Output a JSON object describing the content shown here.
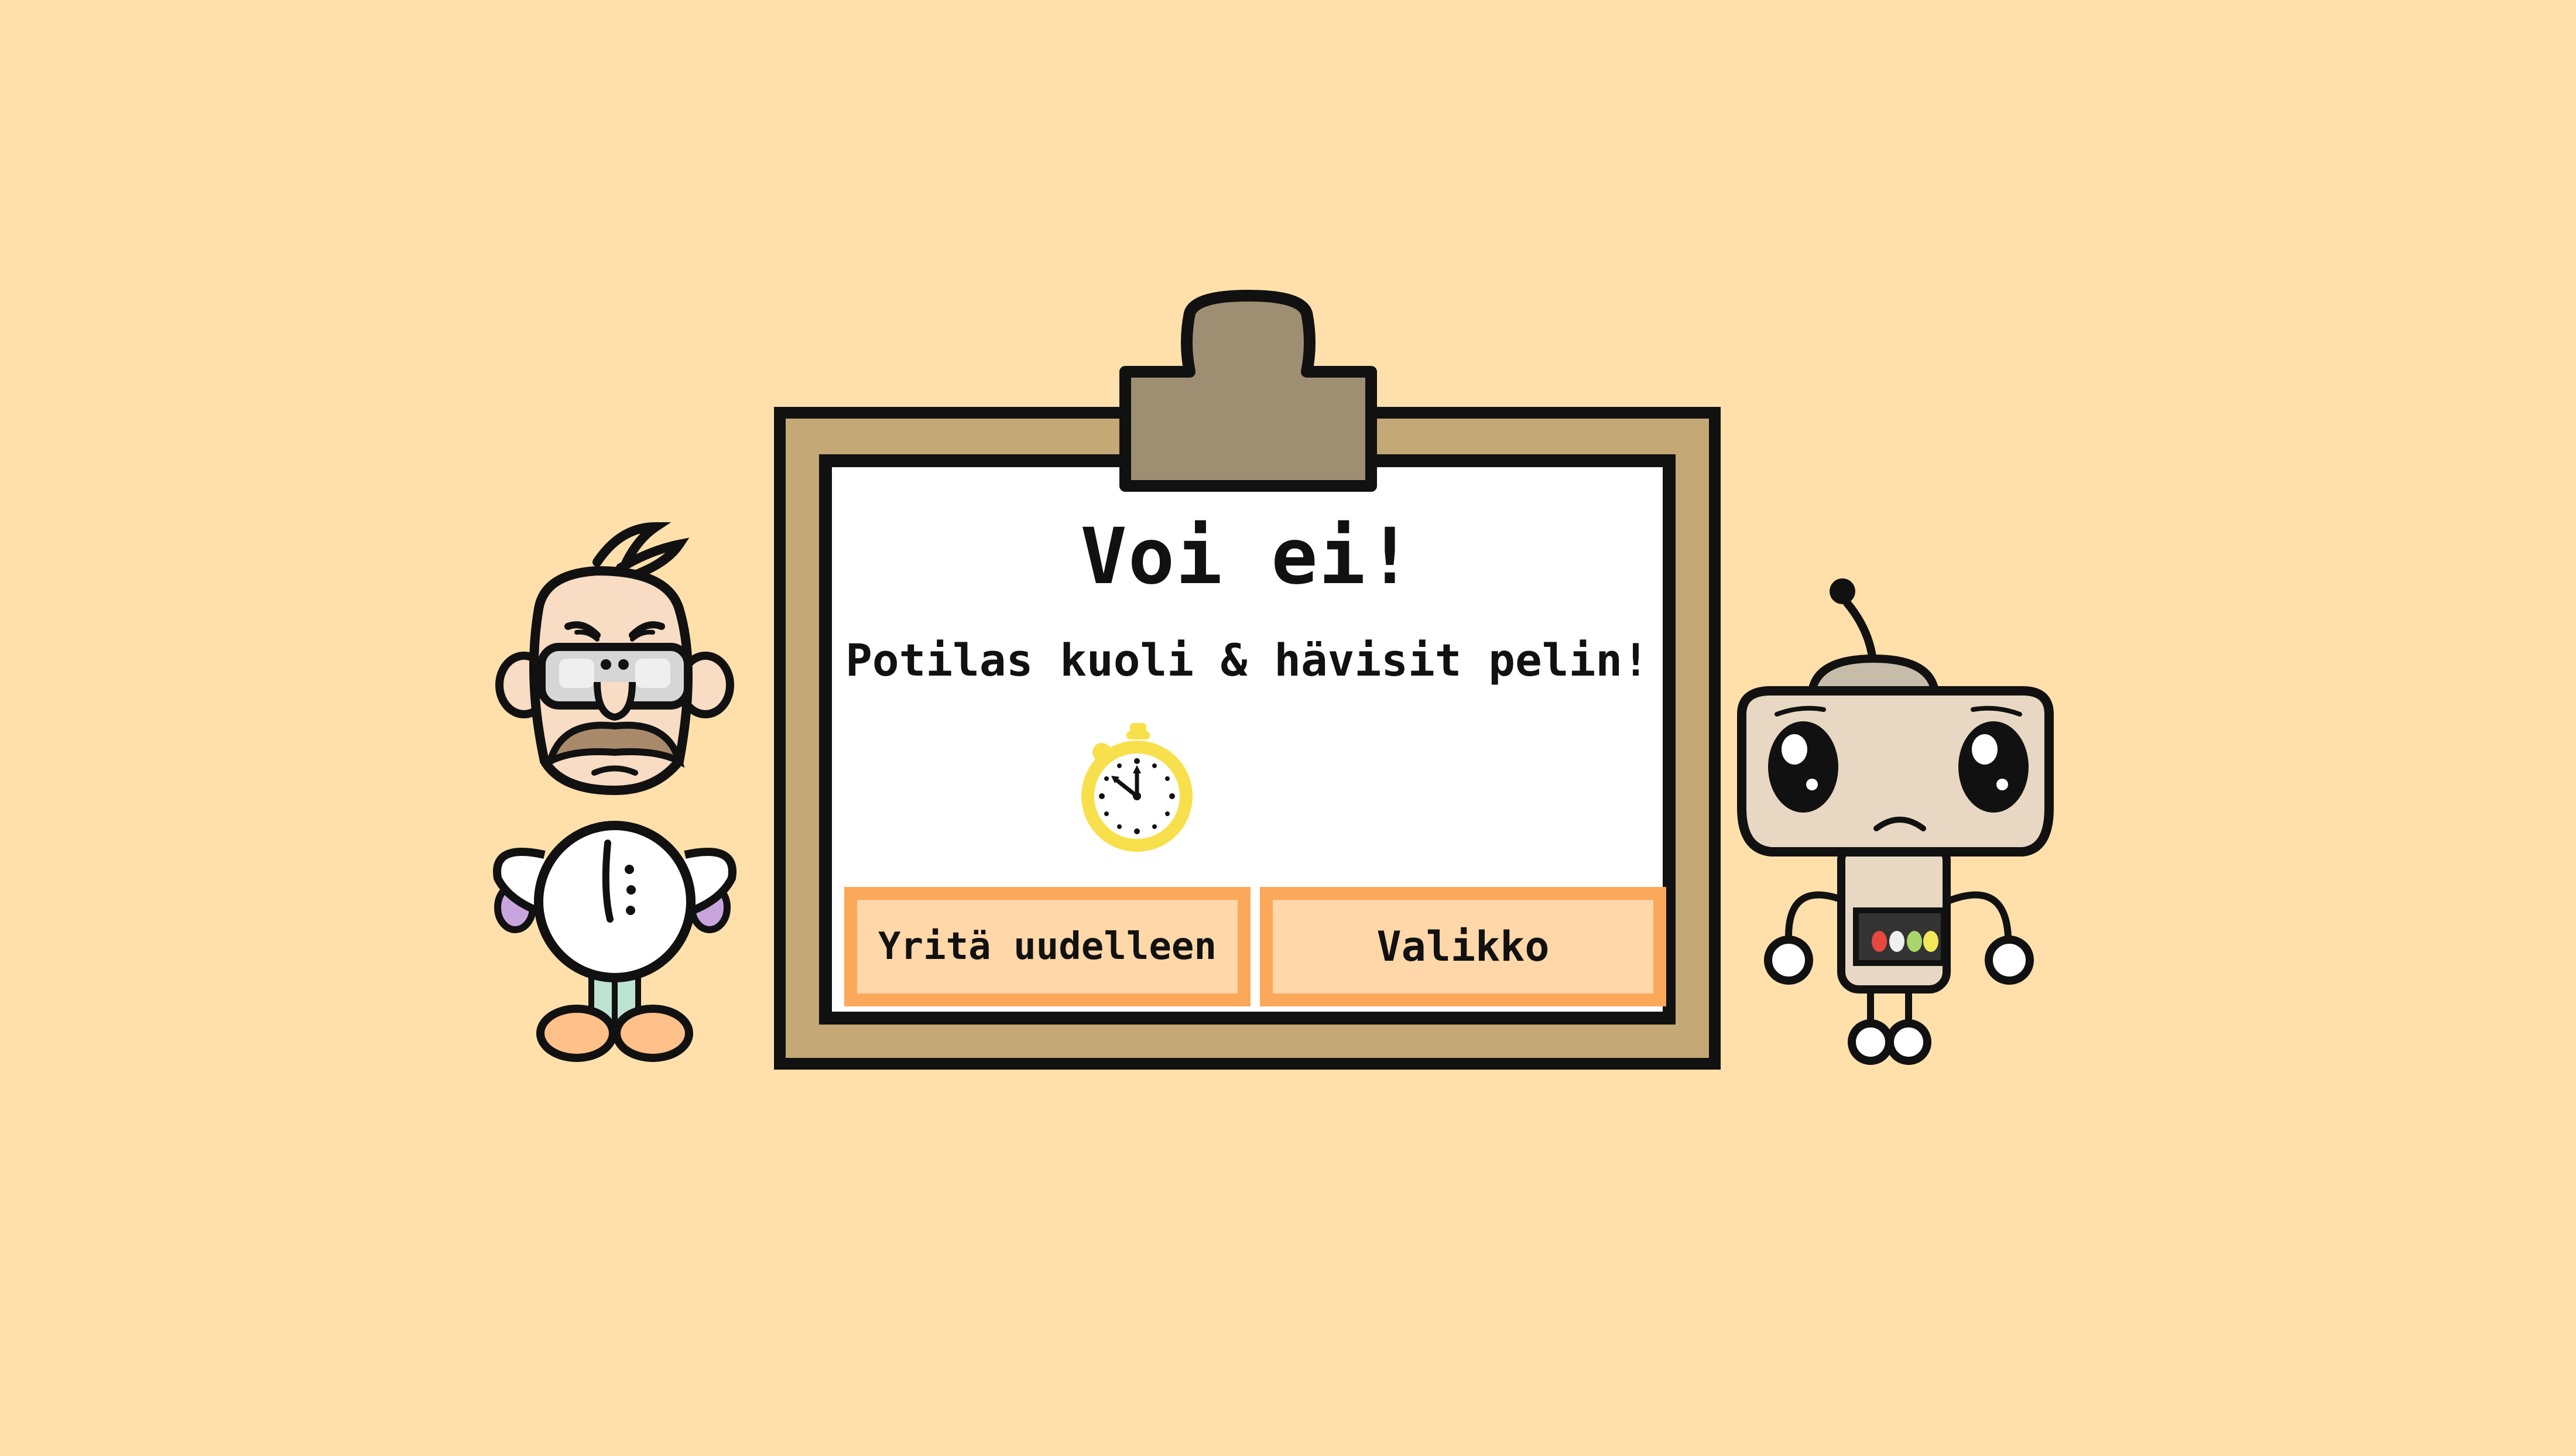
{
  "dialog": {
    "title": "Voi ei!",
    "message": "Potilas kuoli & hävisit pelin!",
    "icon": "stopwatch-icon"
  },
  "buttons": {
    "retry_label": "Yritä uudelleen",
    "menu_label": "Valikko"
  },
  "characters": {
    "left": "scientist-doctor",
    "right": "robot-patient"
  },
  "colors": {
    "background": "#FFE0AB",
    "board": "#C4A875",
    "clip": "#9E8F72",
    "paper": "#FFFFFF",
    "button_fill": "#FFD7A8",
    "button_border": "#FCA85A",
    "stopwatch": "#F7E04B"
  }
}
